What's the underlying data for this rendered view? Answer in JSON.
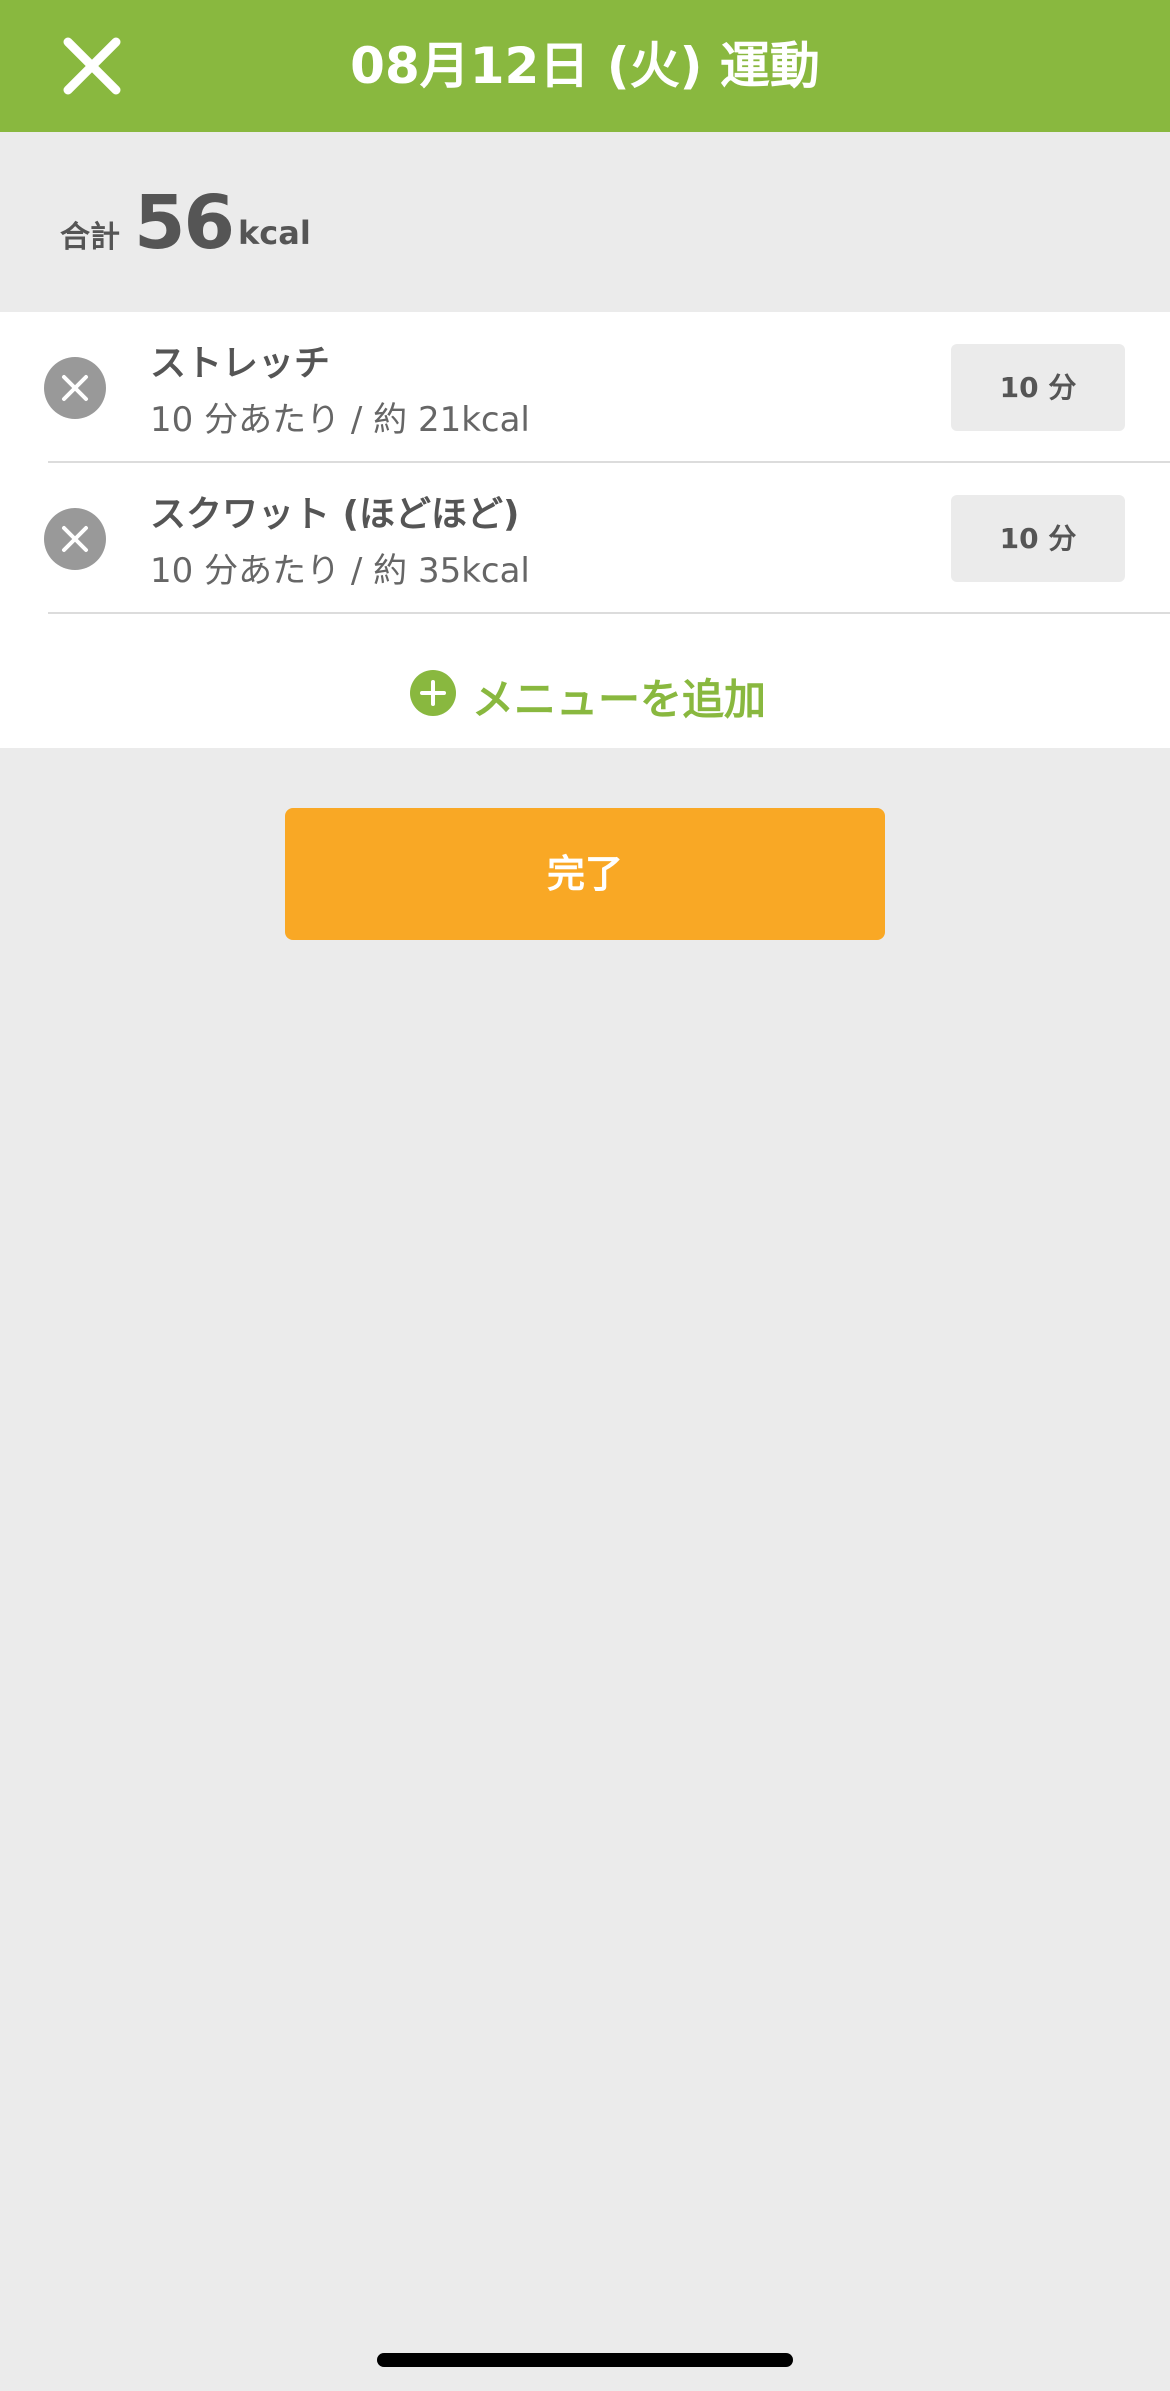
{
  "header": {
    "title": "08月12日 (火) 運動",
    "close_icon": "close-icon"
  },
  "summary": {
    "label": "合計",
    "value": "56",
    "unit": "kcal"
  },
  "items": [
    {
      "name": "ストレッチ",
      "detail": "10 分あたり / 約 21kcal",
      "duration": "10 分"
    },
    {
      "name": "スクワット (ほどほど)",
      "detail": "10 分あたり / 約 35kcal",
      "duration": "10 分"
    }
  ],
  "add_menu": {
    "label": "メニューを追加",
    "icon": "plus-circle-icon"
  },
  "done_button": {
    "label": "完了"
  },
  "colors": {
    "header_bg": "#89b83f",
    "accent_green": "#89b83f",
    "done_orange": "#f9a825",
    "page_bg": "#ebebeb",
    "text_gray": "#555555"
  }
}
